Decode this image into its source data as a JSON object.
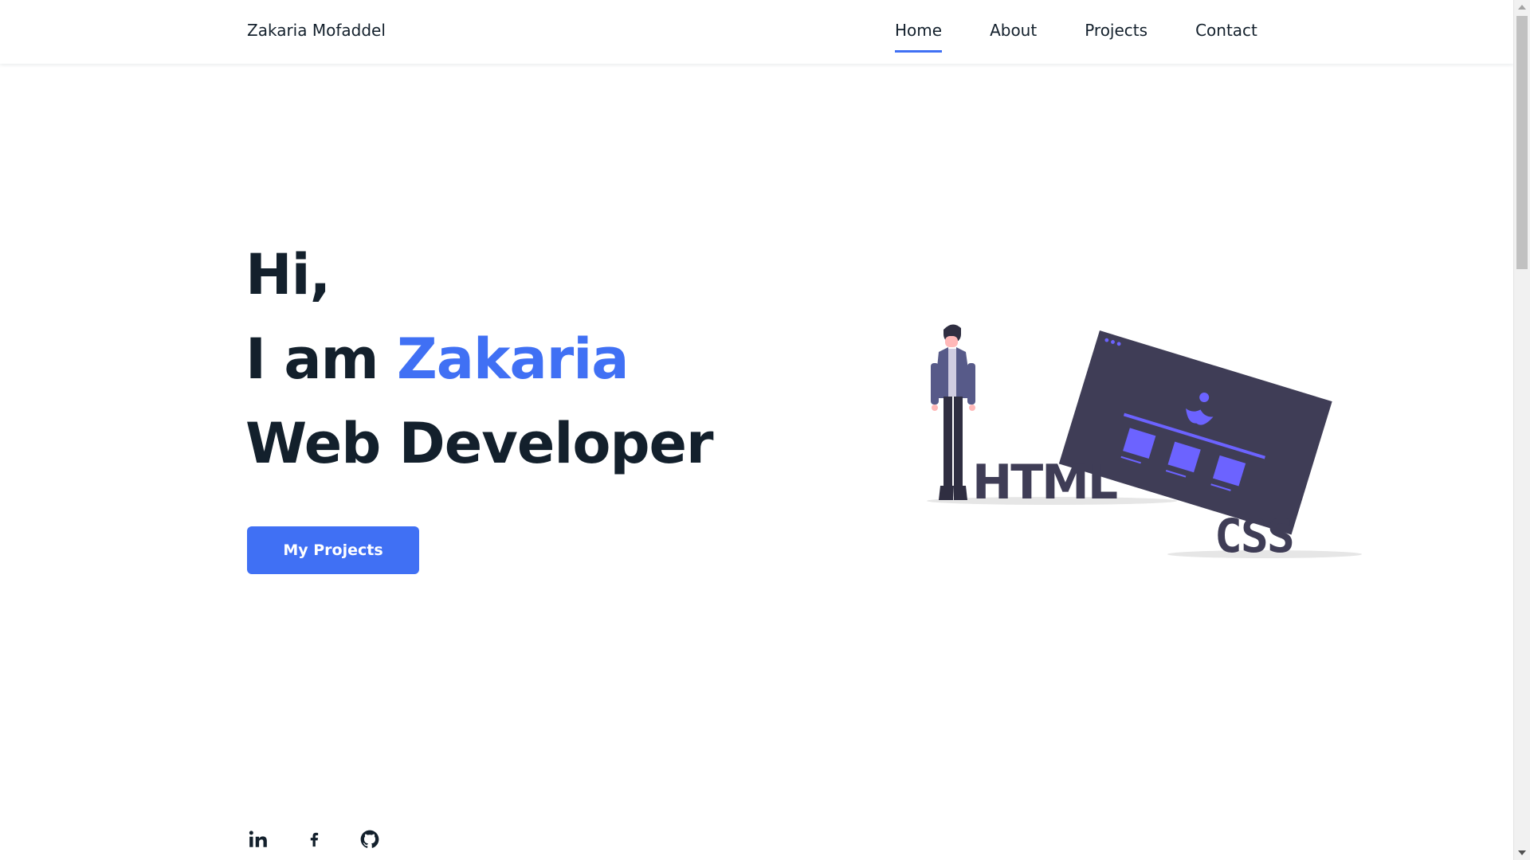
{
  "header": {
    "logo": "Zakaria Mofaddel",
    "nav": [
      {
        "label": "Home",
        "active": true
      },
      {
        "label": "About",
        "active": false
      },
      {
        "label": "Projects",
        "active": false
      },
      {
        "label": "Contact",
        "active": false
      }
    ]
  },
  "hero": {
    "line1": "Hi,",
    "line2_prefix": "I am ",
    "line2_name": "Zakaria",
    "line3": "Web Developer",
    "cta_label": "My Projects"
  },
  "illustration": {
    "html_text": "HTML",
    "css_text": "CSS"
  },
  "socials": [
    {
      "icon": "linkedin-icon"
    },
    {
      "icon": "facebook-icon"
    },
    {
      "icon": "github-icon"
    }
  ],
  "colors": {
    "accent": "#4070f4",
    "text": "#13202c",
    "illustration_dark": "#3f3d56",
    "illustration_purple": "#6c63ff"
  }
}
